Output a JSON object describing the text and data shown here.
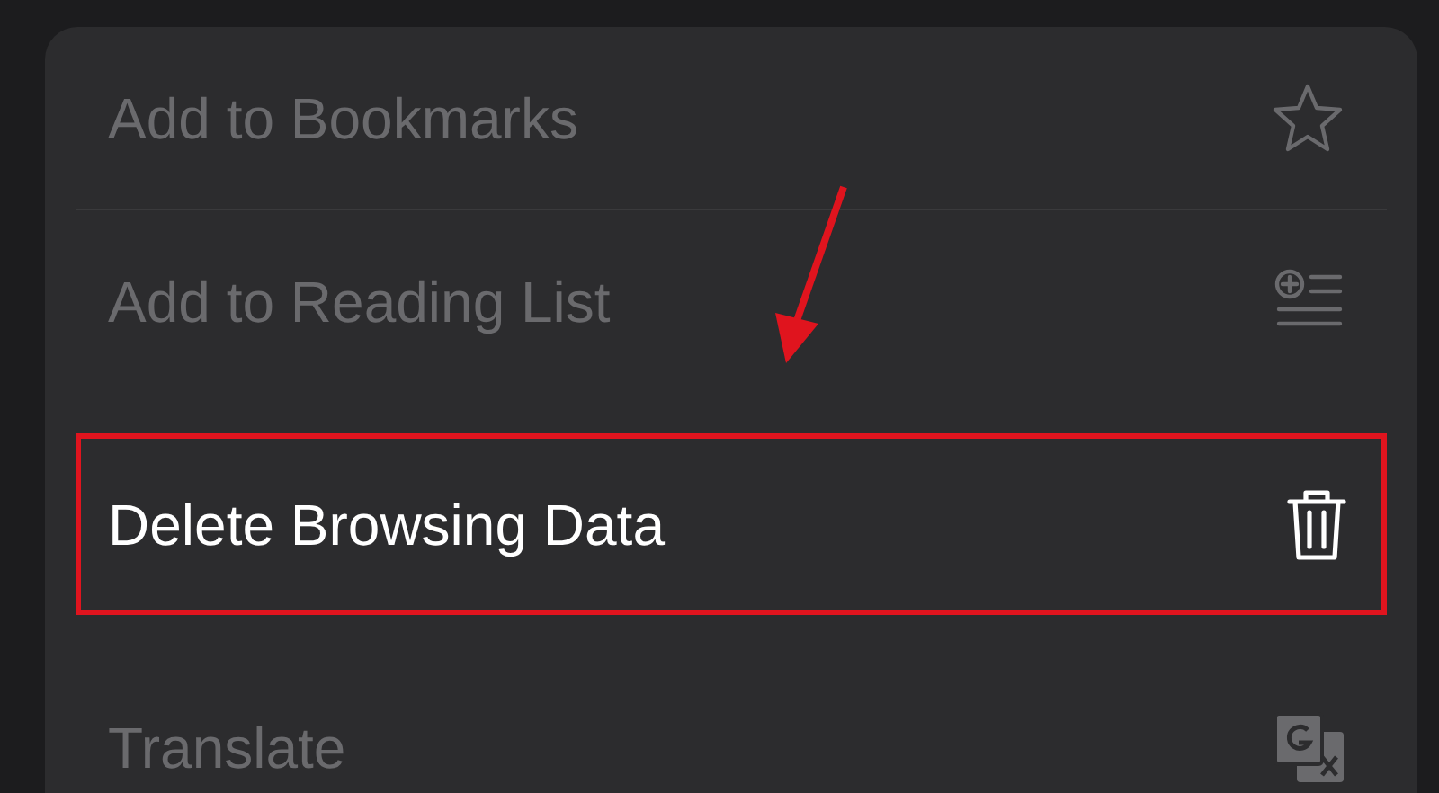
{
  "menu": {
    "items": [
      {
        "label": "Add to Bookmarks",
        "kind": "star",
        "highlighted": false
      },
      {
        "label": "Add to Reading List",
        "kind": "reading-list",
        "highlighted": false
      },
      {
        "label": "Delete Browsing Data",
        "kind": "trash",
        "highlighted": true
      },
      {
        "label": "Translate",
        "kind": "translate",
        "highlighted": false
      }
    ]
  }
}
